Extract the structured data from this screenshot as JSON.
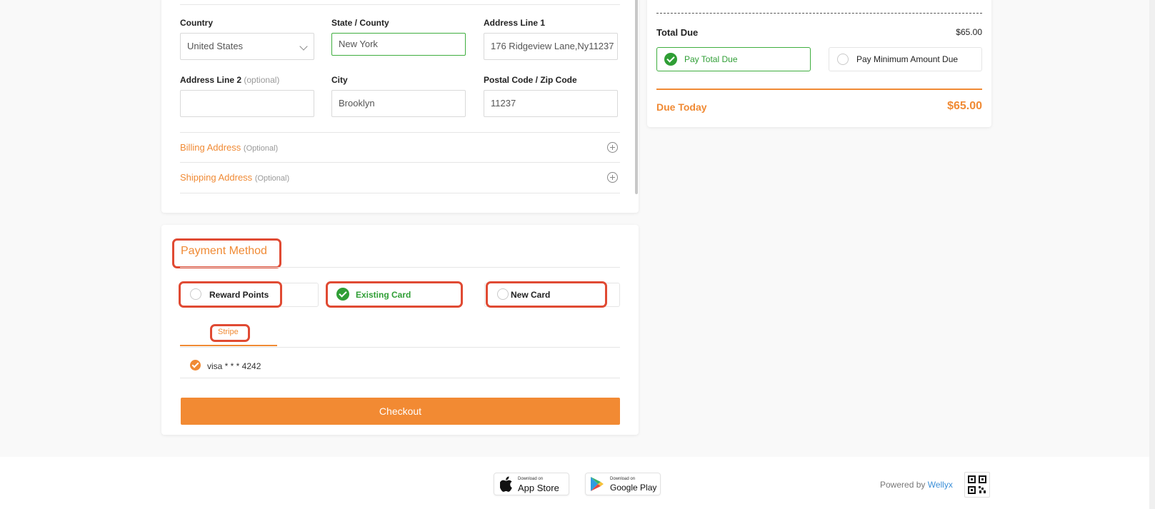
{
  "address": {
    "country_label": "Country",
    "country_value": "United States",
    "state_label": "State / County",
    "state_value": "New York",
    "address1_label": "Address Line 1",
    "address1_value": "176 Ridgeview Lane,Ny11237",
    "address2_label": "Address Line 2",
    "address2_optional": "(optional)",
    "address2_value": "",
    "city_label": "City",
    "city_value": "Brooklyn",
    "postal_label": "Postal Code / Zip Code",
    "postal_value": "11237"
  },
  "billing": {
    "title": "Billing Address",
    "optional": "(Optional)"
  },
  "shipping": {
    "title": "Shipping Address",
    "optional": "(Optional)"
  },
  "payment": {
    "title": "Payment Method",
    "options": [
      "Reward Points",
      "Existing Card",
      "New Card"
    ],
    "selected_option": "Existing Card",
    "gateway_tab": "Stripe",
    "saved_card": "visa * * * 4242",
    "checkout_label": "Checkout"
  },
  "summary": {
    "total_due_label": "Total Due",
    "total_due_value": "$65.00",
    "pay_total_label": "Pay Total Due",
    "pay_min_label": "Pay Minimum Amount Due",
    "selected_pay": "Pay Total Due",
    "due_today_label": "Due Today",
    "due_today_value": "$65.00"
  },
  "footer": {
    "appstore_small": "Download on",
    "appstore_big": "App Store",
    "googleplay_small": "Download on",
    "googleplay_big": "Google Play",
    "powered_by": "Powered by",
    "brand": "Wellyx"
  },
  "icons": [
    "chevron-down-icon",
    "plus-circle-icon",
    "check-circle-icon",
    "radio-icon",
    "apple-icon",
    "google-play-icon",
    "qr-code-icon"
  ],
  "colors": {
    "accent": "#f08a34",
    "success": "#2f9e35",
    "highlight_box": "#e04a33",
    "link": "#3b8fd8"
  }
}
